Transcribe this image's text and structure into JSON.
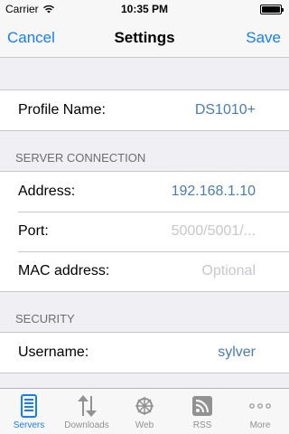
{
  "status_bar": {
    "carrier": "Carrier",
    "time": "10:35 PM"
  },
  "nav": {
    "cancel": "Cancel",
    "title": "Settings",
    "save": "Save"
  },
  "profile": {
    "label": "Profile Name:",
    "value": "DS1010+"
  },
  "server_connection": {
    "header": "SERVER CONNECTION",
    "address_label": "Address:",
    "address_value": "192.168.1.10",
    "port_label": "Port:",
    "port_placeholder": "5000/5001/...",
    "mac_label": "MAC address:",
    "mac_placeholder": "Optional"
  },
  "security": {
    "header": "SECURITY",
    "username_label": "Username:",
    "username_value": "sylver"
  },
  "tabs": [
    {
      "label": "Servers",
      "icon": "servers-icon",
      "active": true
    },
    {
      "label": "Downloads",
      "icon": "downloads-icon",
      "active": false
    },
    {
      "label": "Web",
      "icon": "web-icon",
      "active": false
    },
    {
      "label": "RSS",
      "icon": "rss-icon",
      "active": false
    },
    {
      "label": "More",
      "icon": "more-icon",
      "active": false
    }
  ],
  "colors": {
    "accent": "#147efb",
    "value_text": "#4a7bb5",
    "placeholder": "#c7c7cd",
    "background": "#efeff4",
    "tab_inactive": "#929292"
  }
}
